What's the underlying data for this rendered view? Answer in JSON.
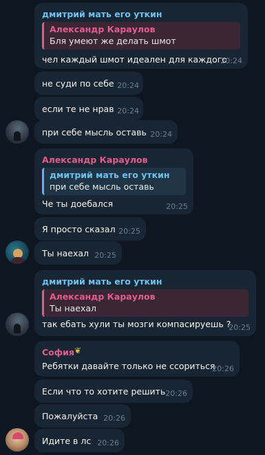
{
  "messages": [
    {
      "sender": "дмитрий мать его уткин",
      "reply_name": "Александр Караулов",
      "reply_text": "Бля умеют же делать шмот",
      "text": "чел каждый шмот идеален для каждого",
      "time": "20:24"
    },
    {
      "text": "не суди по себе",
      "time": "20:24"
    },
    {
      "text": "если те не нрав",
      "time": "20:24"
    },
    {
      "text": "при себе мысль оставь",
      "time": "20:24"
    },
    {
      "sender": "Александр Караулов",
      "reply_name": "дмитрий мать его уткин",
      "reply_text": "при себе мысль оставь",
      "text": "Че ты доебался",
      "time": "20:25"
    },
    {
      "text": "Я просто сказал",
      "time": "20:25"
    },
    {
      "text": "Ты наехал",
      "time": "20:25"
    },
    {
      "sender": "дмитрий мать его уткин",
      "reply_name": "Александр Караулов",
      "reply_text": "Ты наехал",
      "text": "так ебать хули ты мозги компасируешь ?",
      "time": "20:25"
    },
    {
      "sender": "София",
      "text": "Ребятки давайте только не ссориться",
      "time": "20:26"
    },
    {
      "text": "Если что то хотите решить",
      "time": "20:26"
    },
    {
      "text": "Пожалуйста",
      "time": "20:26"
    },
    {
      "text": "Идите в лс",
      "time": "20:26"
    }
  ],
  "colors": {
    "background": "#0e1621",
    "bubble": "#182533",
    "dmitry_name": "#6ec1f0",
    "alexander_name": "#e35d8f",
    "sofia_name": "#e35d8f"
  }
}
